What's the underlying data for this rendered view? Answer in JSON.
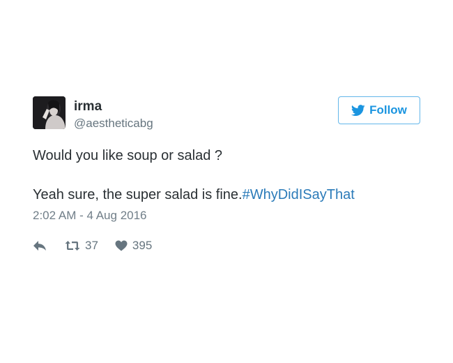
{
  "tweet": {
    "author": {
      "display_name": "irma",
      "handle": "@aestheticabg",
      "avatar_icon": "profile-photo"
    },
    "follow_button": {
      "label": "Follow",
      "icon": "twitter-bird-icon",
      "color": "#1b95e0"
    },
    "text_line1": "Would you like soup or salad ?",
    "text_line2": "Yeah sure, the super salad is fine.",
    "hashtag": "#WhyDidISayThat",
    "timestamp": "2:02 AM - 4 Aug 2016",
    "actions": {
      "reply_icon": "reply-icon",
      "retweet_icon": "retweet-icon",
      "retweet_count": "37",
      "like_icon": "heart-icon",
      "like_count": "395"
    },
    "colors": {
      "text": "#292f33",
      "muted": "#66757f",
      "link": "#2b7bb9",
      "button_border": "#62b6ea"
    }
  }
}
